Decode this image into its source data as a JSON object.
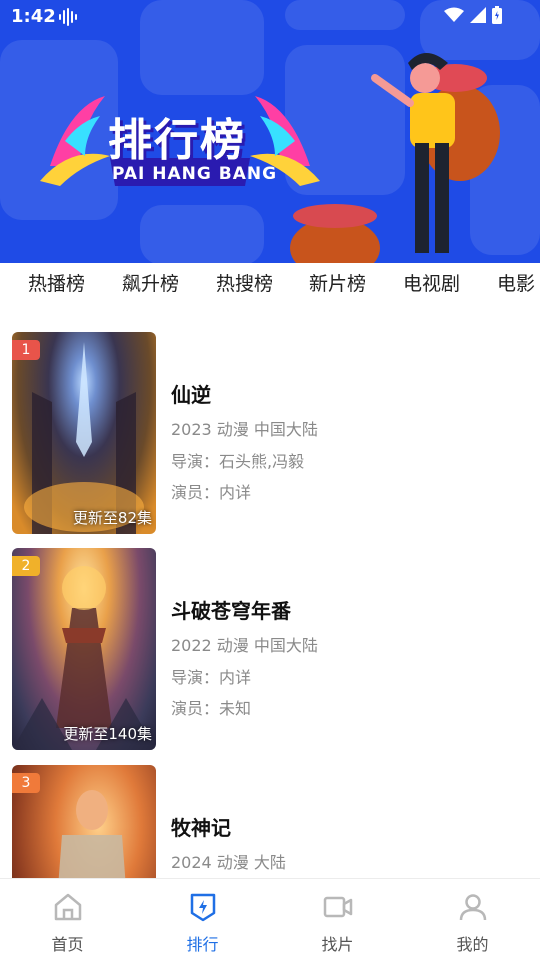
{
  "status_bar": {
    "time": "1:42"
  },
  "banner": {
    "title": "排行榜",
    "subtitle": "PAI HANG BANG"
  },
  "tabs": [
    "热播榜",
    "飙升榜",
    "热搜榜",
    "新片榜",
    "电视剧",
    "电影"
  ],
  "list": [
    {
      "rank": "1",
      "title": "仙逆",
      "info": "2023 动漫 中国大陆",
      "director": "导演：石头熊,冯毅",
      "cast": "演员：内详",
      "episodes": "更新至82集",
      "badge_color": "#e8544a"
    },
    {
      "rank": "2",
      "title": "斗破苍穹年番",
      "info": "2022 动漫 中国大陆",
      "director": "导演：内详",
      "cast": "演员：未知",
      "episodes": "更新至140集",
      "badge_color": "#f0b12a"
    },
    {
      "rank": "3",
      "title": "牧神记",
      "info": "2024 动漫 大陆",
      "director": "",
      "cast": "",
      "episodes": "",
      "badge_color": "#f07a3a"
    }
  ],
  "bottom_nav": [
    {
      "label": "首页",
      "icon": "home-icon",
      "active": false
    },
    {
      "label": "排行",
      "icon": "ranking-icon",
      "active": true
    },
    {
      "label": "找片",
      "icon": "video-camera-icon",
      "active": false
    },
    {
      "label": "我的",
      "icon": "person-icon",
      "active": false
    }
  ],
  "colors": {
    "banner": "#1f4be6",
    "accent": "#1f6fe5"
  }
}
